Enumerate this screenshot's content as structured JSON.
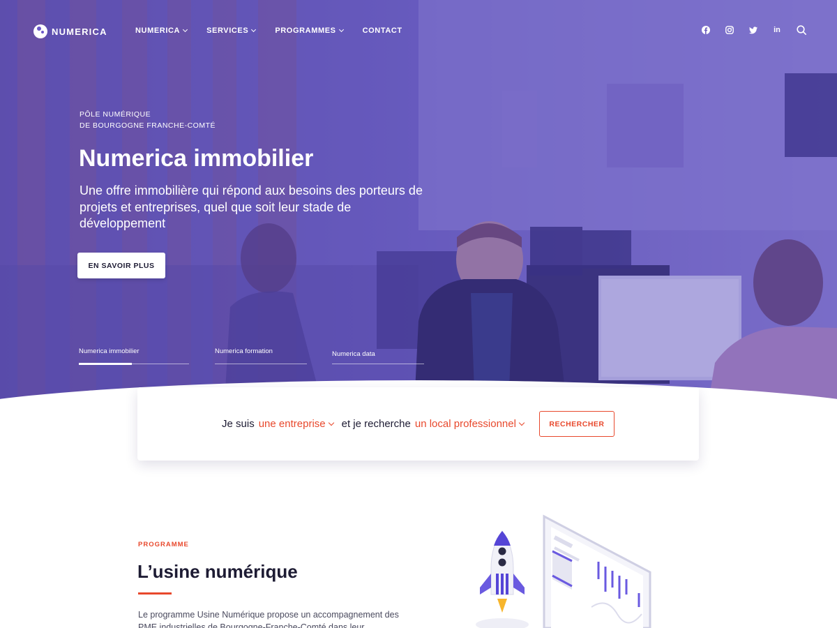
{
  "header": {
    "logo_text": "NUMERICA",
    "nav": [
      {
        "label": "NUMERICA",
        "dropdown": true
      },
      {
        "label": "SERVICES",
        "dropdown": true
      },
      {
        "label": "PROGRAMMES",
        "dropdown": true
      },
      {
        "label": "CONTACT",
        "dropdown": false
      }
    ],
    "social_icons": [
      "facebook-icon",
      "instagram-icon",
      "twitter-icon",
      "linkedin-icon",
      "search-icon"
    ],
    "linkedin_glyph": "in"
  },
  "hero": {
    "eyebrow_line1": "PÔLE NUMÉRIQUE",
    "eyebrow_line2": "DE BOURGOGNE FRANCHE-COMTÉ",
    "title": "Numerica immobilier",
    "subtitle": "Une offre immobilière qui répond aux besoins des porteurs de projets et entreprises, quel que soit leur stade de développement",
    "cta_label": "EN SAVOIR PLUS",
    "tabs": [
      {
        "label": "Numerica immobilier",
        "active": true
      },
      {
        "label": "Numerica formation",
        "active": false
      },
      {
        "label": "Numerica data",
        "active": false
      }
    ]
  },
  "search": {
    "prefix": "Je suis",
    "who_value": "une entreprise",
    "middle": "et je recherche",
    "what_value": "un local professionnel",
    "button_label": "RECHERCHER"
  },
  "programme": {
    "label": "PROGRAMME",
    "title": "L’usine numérique",
    "description": "Le programme Usine Numérique propose un accompagnement des PME industrielles de Bourgogne-Franche-Comté dans leur"
  },
  "colors": {
    "accent": "#e8482c",
    "overlay": "#5a4bc0",
    "dark_text": "#1d1b33"
  }
}
